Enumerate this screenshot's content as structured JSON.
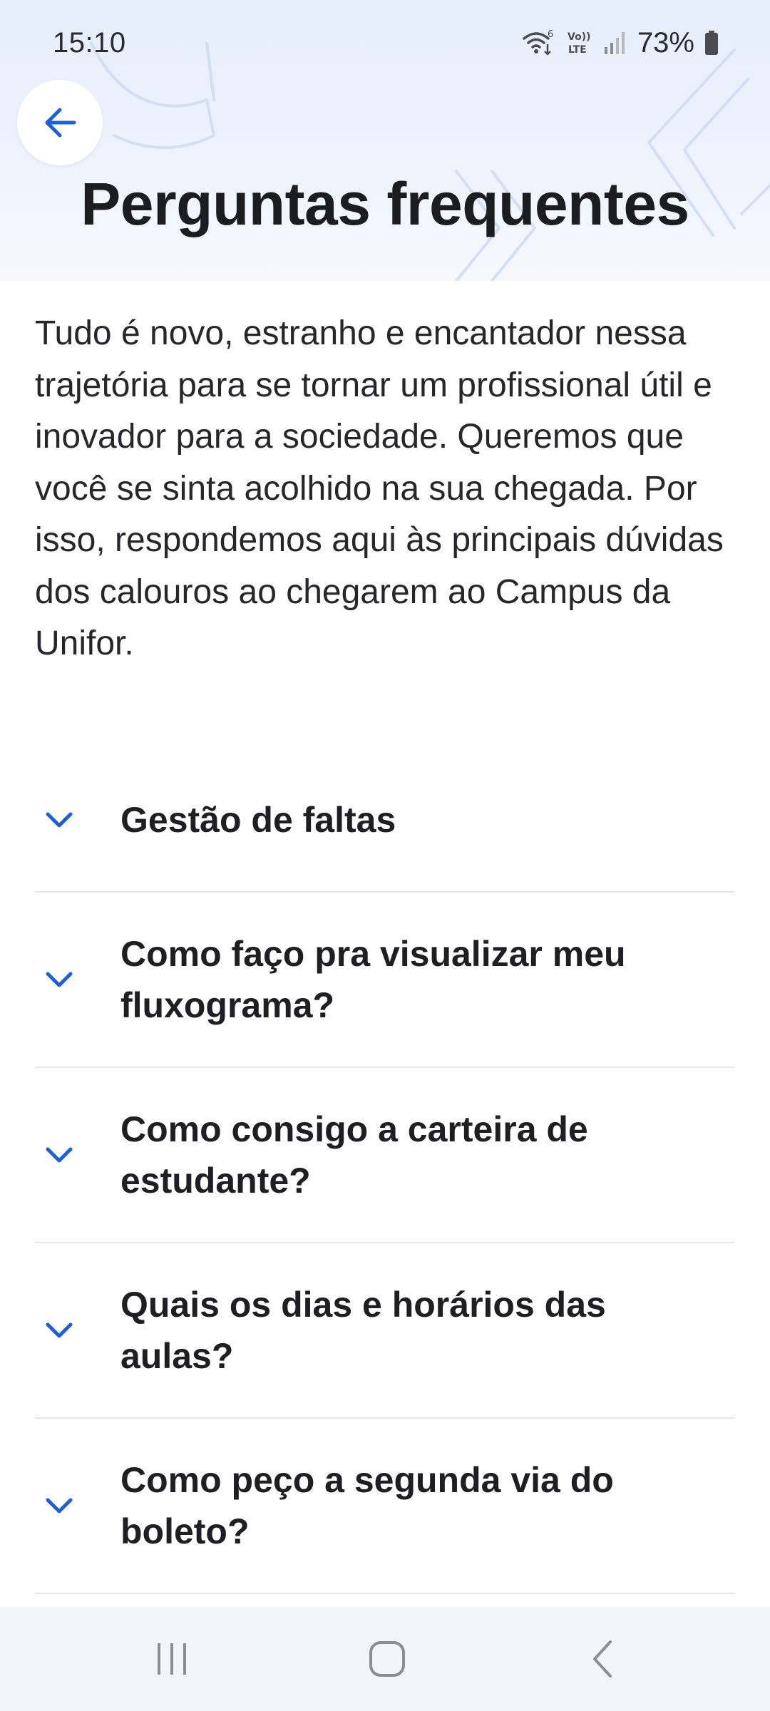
{
  "status_bar": {
    "time": "15:10",
    "battery_percent": "73%",
    "icons": [
      "wifi-icon",
      "volte-icon",
      "signal-icon",
      "battery-icon"
    ],
    "volte_label_top": "Vo))",
    "volte_label_bottom": "LTE",
    "wifi_badge": "6"
  },
  "header": {
    "back_icon": "arrow-left-icon",
    "title": "Perguntas frequentes"
  },
  "intro": {
    "text": "Tudo é novo, estranho e encantador nessa trajetória para se tornar um profissional útil e inovador para a sociedade. Queremos que você se sinta acolhido na sua chegada. Por isso, respondemos aqui às principais dúvidas dos calouros ao chegarem ao Campus da Unifor."
  },
  "faq": {
    "items": [
      {
        "question": "Gestão de faltas",
        "expanded": false
      },
      {
        "question": "Como faço pra visualizar meu fluxograma?",
        "expanded": false
      },
      {
        "question": "Como consigo a carteira de estudante?",
        "expanded": false
      },
      {
        "question": "Quais os dias e horários das aulas?",
        "expanded": false
      },
      {
        "question": "Como peço a segunda via do boleto?",
        "expanded": false
      }
    ]
  },
  "nav_bar": {
    "recents_icon": "recents-icon",
    "home_icon": "home-icon",
    "back_icon": "back-chevron-icon"
  },
  "colors": {
    "accent": "#1f5fd6",
    "header_bg": "#e9f0fc",
    "divider": "#e6e7ea",
    "text": "#1f1f23"
  }
}
